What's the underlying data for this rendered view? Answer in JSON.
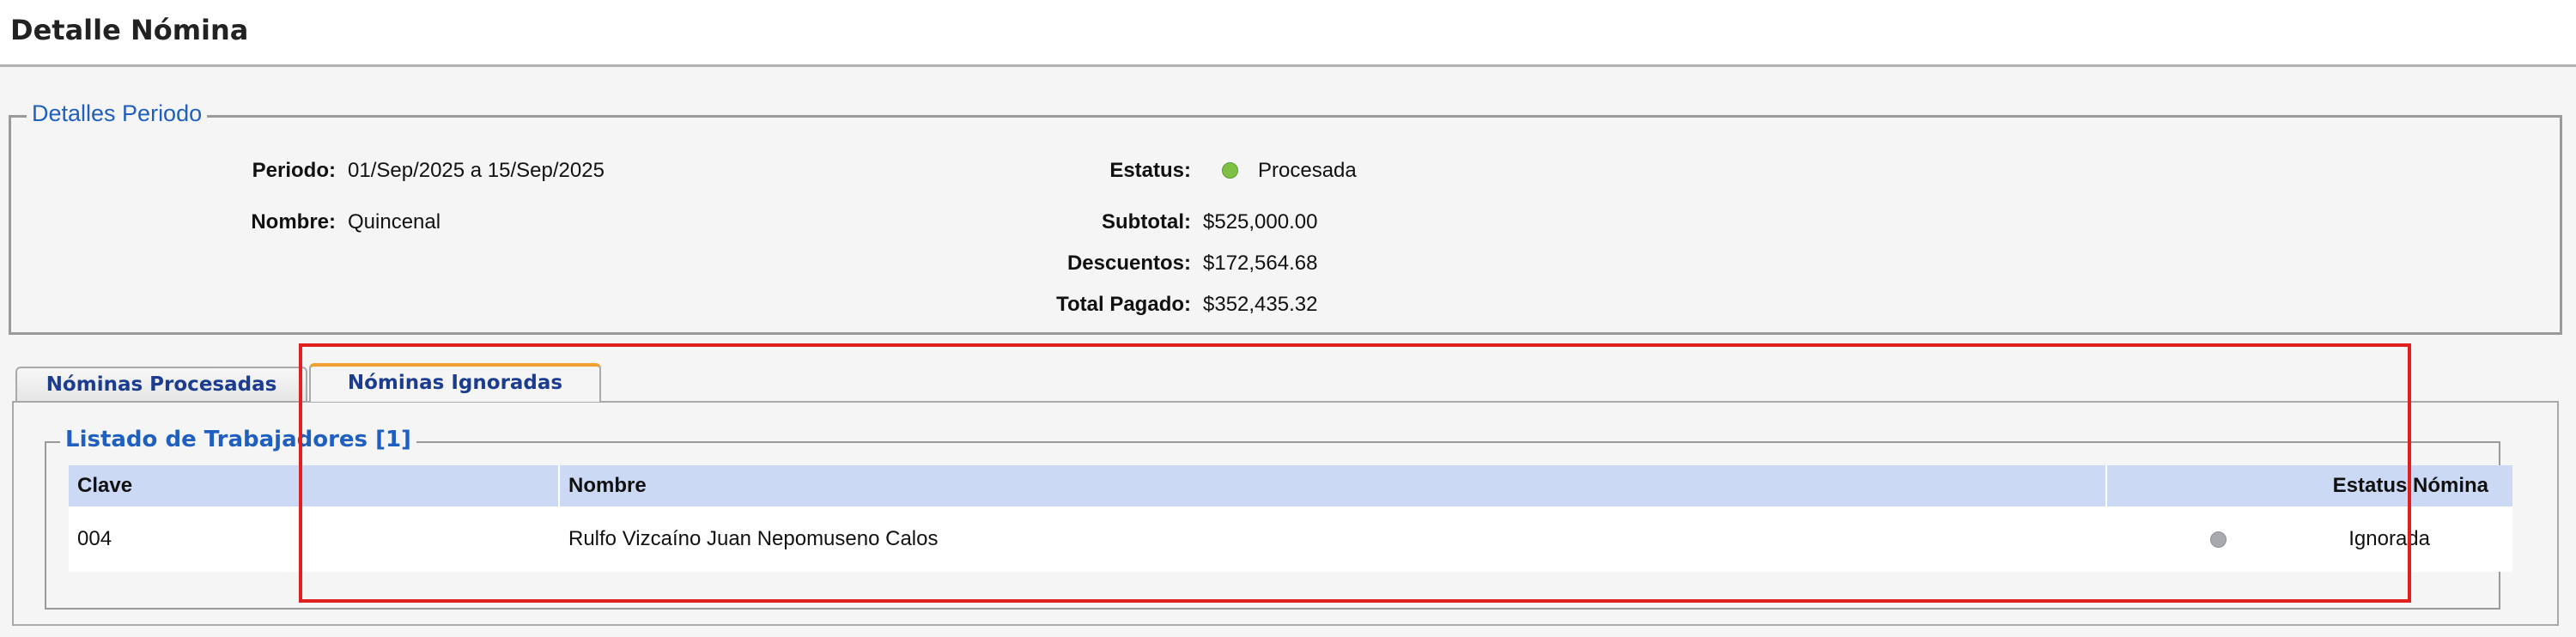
{
  "page": {
    "title": "Detalle Nómina"
  },
  "details": {
    "legend": "Detalles Periodo",
    "periodo_label": "Periodo:",
    "periodo_value": "01/Sep/2025 a 15/Sep/2025",
    "nombre_label": "Nombre:",
    "nombre_value": "Quincenal",
    "estatus_label": "Estatus:",
    "estatus_value": "Procesada",
    "estatus_color": "#7ec043",
    "subtotal_label": "Subtotal:",
    "subtotal_value": "$525,000.00",
    "descuentos_label": "Descuentos:",
    "descuentos_value": "$172,564.68",
    "total_label": "Total Pagado:",
    "total_value": "$352,435.32"
  },
  "tabs": [
    {
      "label": "Nóminas Procesadas",
      "active": false
    },
    {
      "label": "Nóminas Ignoradas",
      "active": true
    }
  ],
  "listado": {
    "legend": "Listado de Trabajadores [1]",
    "columns": [
      "Clave",
      "Nombre",
      "Estatus Nómina"
    ],
    "rows": [
      {
        "clave": "004",
        "nombre": "Rulfo Vizcaíno Juan Nepomuseno Calos",
        "estatus": "Ignorada",
        "estatus_color": "#a7a9ad"
      }
    ]
  },
  "highlight_color": "#e0201e"
}
